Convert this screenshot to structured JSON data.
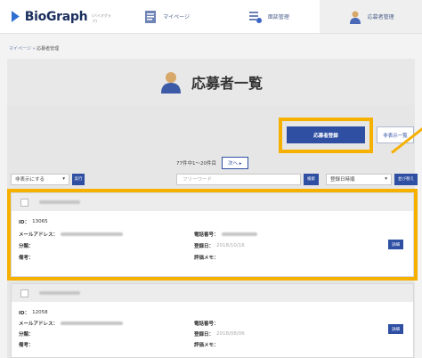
{
  "header": {
    "logo_text": "BioGraph",
    "logo_sub": "(バイオグラフ)",
    "nav": [
      {
        "label": "マイページ",
        "icon": "document-icon"
      },
      {
        "label": "面談管理",
        "icon": "schedule-grid-icon"
      },
      {
        "label": "応募者管理",
        "icon": "person-icon"
      }
    ]
  },
  "breadcrumb": {
    "root": "マイページ",
    "sep": "»",
    "current": "応募者管理"
  },
  "page_title": "応募者一覧",
  "actions": {
    "register": "応募者登録",
    "hidden_list": "非表示一覧"
  },
  "pager": {
    "summary": "77件中1〜20件目",
    "next": "次へ ▸"
  },
  "toolbar": {
    "bulk_select": "非表示にする",
    "run": "実行",
    "search_placeholder": "フリーワード",
    "search_btn": "検索",
    "sort_select": "登録日時順",
    "sort_btn": "並び替え"
  },
  "labels": {
    "id": "ID：",
    "mail": "メールアドレス：",
    "category": "分類：",
    "note": "備考：",
    "phone": "電話番号：",
    "regdate": "登録日：",
    "eval": "評価メモ：",
    "detail": "詳細"
  },
  "applicants": [
    {
      "id": "13065",
      "phone": "02298699",
      "regdate": "2018/10/16"
    },
    {
      "id": "12058",
      "phone": "",
      "regdate": "2018/08/06"
    }
  ],
  "colors": {
    "accent": "#2f4fa3",
    "highlight": "#f5b000"
  }
}
